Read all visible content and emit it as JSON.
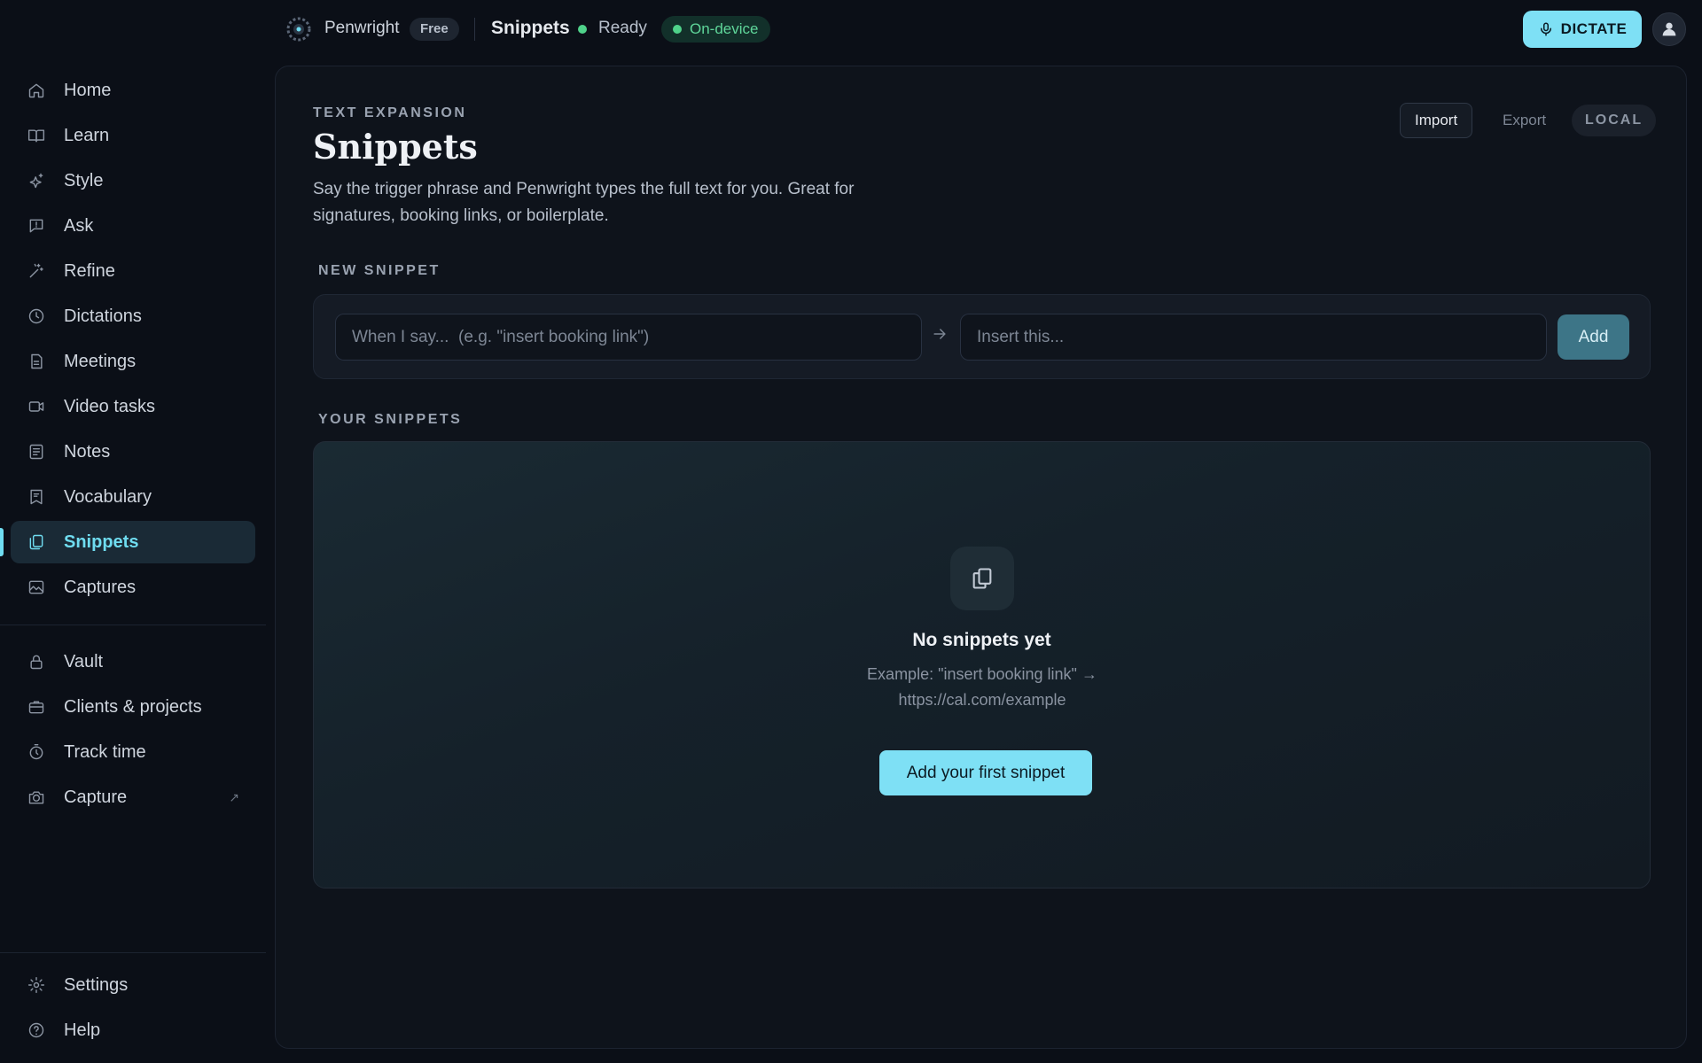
{
  "app": {
    "name": "Penwright",
    "plan": "Free",
    "current_page": "Snippets",
    "status": "Ready",
    "mode": "On-device",
    "dictate_label": "DICTATE"
  },
  "sidebar": {
    "top_items": [
      {
        "label": "Home",
        "icon": "home-icon"
      },
      {
        "label": "Learn",
        "icon": "book-icon"
      },
      {
        "label": "Style",
        "icon": "sparkle-icon"
      },
      {
        "label": "Ask",
        "icon": "chat-icon"
      },
      {
        "label": "Refine",
        "icon": "magic-icon"
      },
      {
        "label": "Dictations",
        "icon": "clock-icon"
      },
      {
        "label": "Meetings",
        "icon": "document-icon"
      },
      {
        "label": "Video tasks",
        "icon": "video-icon"
      },
      {
        "label": "Notes",
        "icon": "notes-icon"
      },
      {
        "label": "Vocabulary",
        "icon": "vocabulary-icon"
      },
      {
        "label": "Snippets",
        "icon": "copy-icon",
        "active": true
      },
      {
        "label": "Captures",
        "icon": "image-icon"
      }
    ],
    "mid_items": [
      {
        "label": "Vault",
        "icon": "lock-icon"
      },
      {
        "label": "Clients & projects",
        "icon": "briefcase-icon"
      },
      {
        "label": "Track time",
        "icon": "timer-icon"
      },
      {
        "label": "Capture",
        "icon": "camera-icon",
        "external": "↗"
      }
    ],
    "bottom_items": [
      {
        "label": "Settings",
        "icon": "gear-icon"
      },
      {
        "label": "Help",
        "icon": "help-icon"
      }
    ]
  },
  "header": {
    "eyebrow": "TEXT EXPANSION",
    "title": "Snippets",
    "description": "Say the trigger phrase and Penwright types the full text for you. Great for signatures, booking links, or boilerplate.",
    "import_label": "Import",
    "export_label": "Export",
    "storage_badge": "LOCAL"
  },
  "new_snippet": {
    "section_label": "NEW SNIPPET",
    "trigger_placeholder": "When I say...  (e.g. \"insert booking link\")",
    "trigger_value": "",
    "insert_placeholder": "Insert this...",
    "insert_value": "",
    "add_label": "Add"
  },
  "your_snippets": {
    "section_label": "YOUR SNIPPETS",
    "empty_title": "No snippets yet",
    "empty_example": "Example: \"insert booking link\" → https://cal.com/example",
    "cta_label": "Add your first snippet"
  },
  "colors": {
    "accent": "#7ee0f5",
    "active_nav": "#6fdcf0",
    "status_green": "#4fd28a",
    "background": "#0b0f17"
  }
}
